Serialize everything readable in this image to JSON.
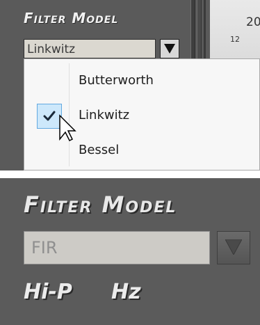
{
  "top_panel": {
    "section_title": "Filter Model",
    "combo_value": "Linkwitz",
    "scale_labels": [
      "20",
      "12"
    ],
    "dropdown_items": [
      "Butterworth",
      "Linkwitz",
      "Bessel"
    ],
    "checked_item": "Linkwitz",
    "dropdown_arrow_icon": "triangle-down-icon",
    "check_icon": "checkmark-icon",
    "cursor_icon": "arrow-cursor-icon"
  },
  "bottom_panel": {
    "section_title": "Filter Model",
    "combo_value": "FIR",
    "dropdown_arrow_icon": "triangle-down-icon",
    "labels": [
      "Hi-P",
      "Hz"
    ]
  },
  "colors": {
    "panel_bg": "#5a5a5a",
    "menu_bg": "#f7f7f7",
    "check_highlight": "#cde8fb",
    "check_border": "#62a9e0"
  }
}
